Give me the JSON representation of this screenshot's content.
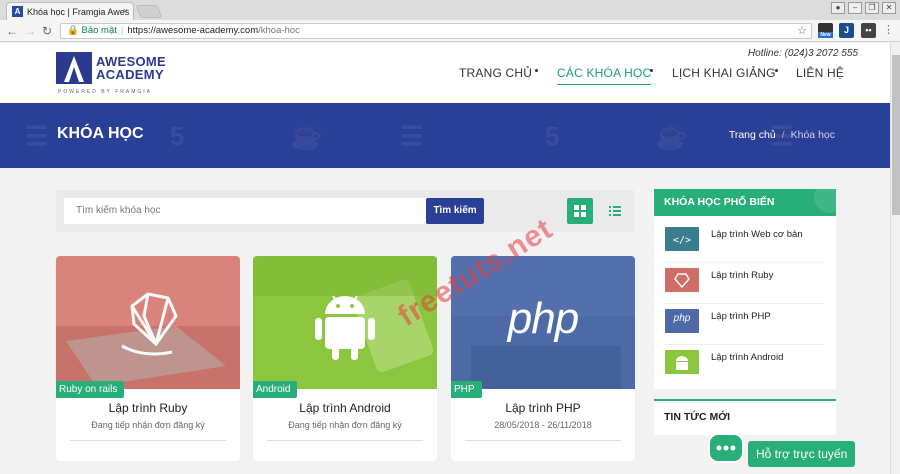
{
  "browser": {
    "tab_title": "Khóa học | Framgia Awes",
    "tab_close": "×",
    "security_label": "Bảo mật",
    "url_host": "https://awesome-academy.com",
    "url_path": "/khoa-hoc",
    "ext_badge": "New"
  },
  "header": {
    "logo_line1": "AWESOME",
    "logo_line2": "ACADEMY",
    "logo_tagline": "POWERED BY FRAMGIA",
    "hotline": "Hotline: (024)3 2072 555",
    "menu": [
      "TRANG CHỦ",
      "CÁC KHÓA HỌC",
      "LỊCH KHAI GIẢNG",
      "LIÊN HỆ"
    ]
  },
  "banner": {
    "title": "KHÓA HỌC",
    "breadcrumb_home": "Trang chủ",
    "breadcrumb_sep": "/",
    "breadcrumb_current": "Khóa học"
  },
  "search": {
    "placeholder": "Tìm kiếm khóa học",
    "button": "Tìm kiếm"
  },
  "courses": [
    {
      "tag": "Ruby on rails",
      "title": "Lập trình Ruby",
      "sub": "Đang tiếp nhận đơn đăng ký"
    },
    {
      "tag": "Android",
      "title": "Lập trình Android",
      "sub": "Đang tiếp nhận đơn đăng ký"
    },
    {
      "tag": "PHP",
      "title": "Lập trình PHP",
      "sub": "28/05/2018 - 26/11/2018",
      "logo": "php"
    }
  ],
  "sidebar": {
    "popular_title": "KHÓA HỌC PHỔ BIẾN",
    "popular": [
      {
        "label": "Lập trình Web cơ bản"
      },
      {
        "label": "Lập trình Ruby"
      },
      {
        "label": "Lập trình PHP",
        "thumb_text": "php"
      },
      {
        "label": "Lập trình Android"
      }
    ],
    "news_title": "TIN TỨC MỚI"
  },
  "support": {
    "label": "Hỗ trợ trực tuyến"
  },
  "watermark": "freetuts.net",
  "colors": {
    "primary": "#2a3f96",
    "accent": "#27ae79"
  }
}
